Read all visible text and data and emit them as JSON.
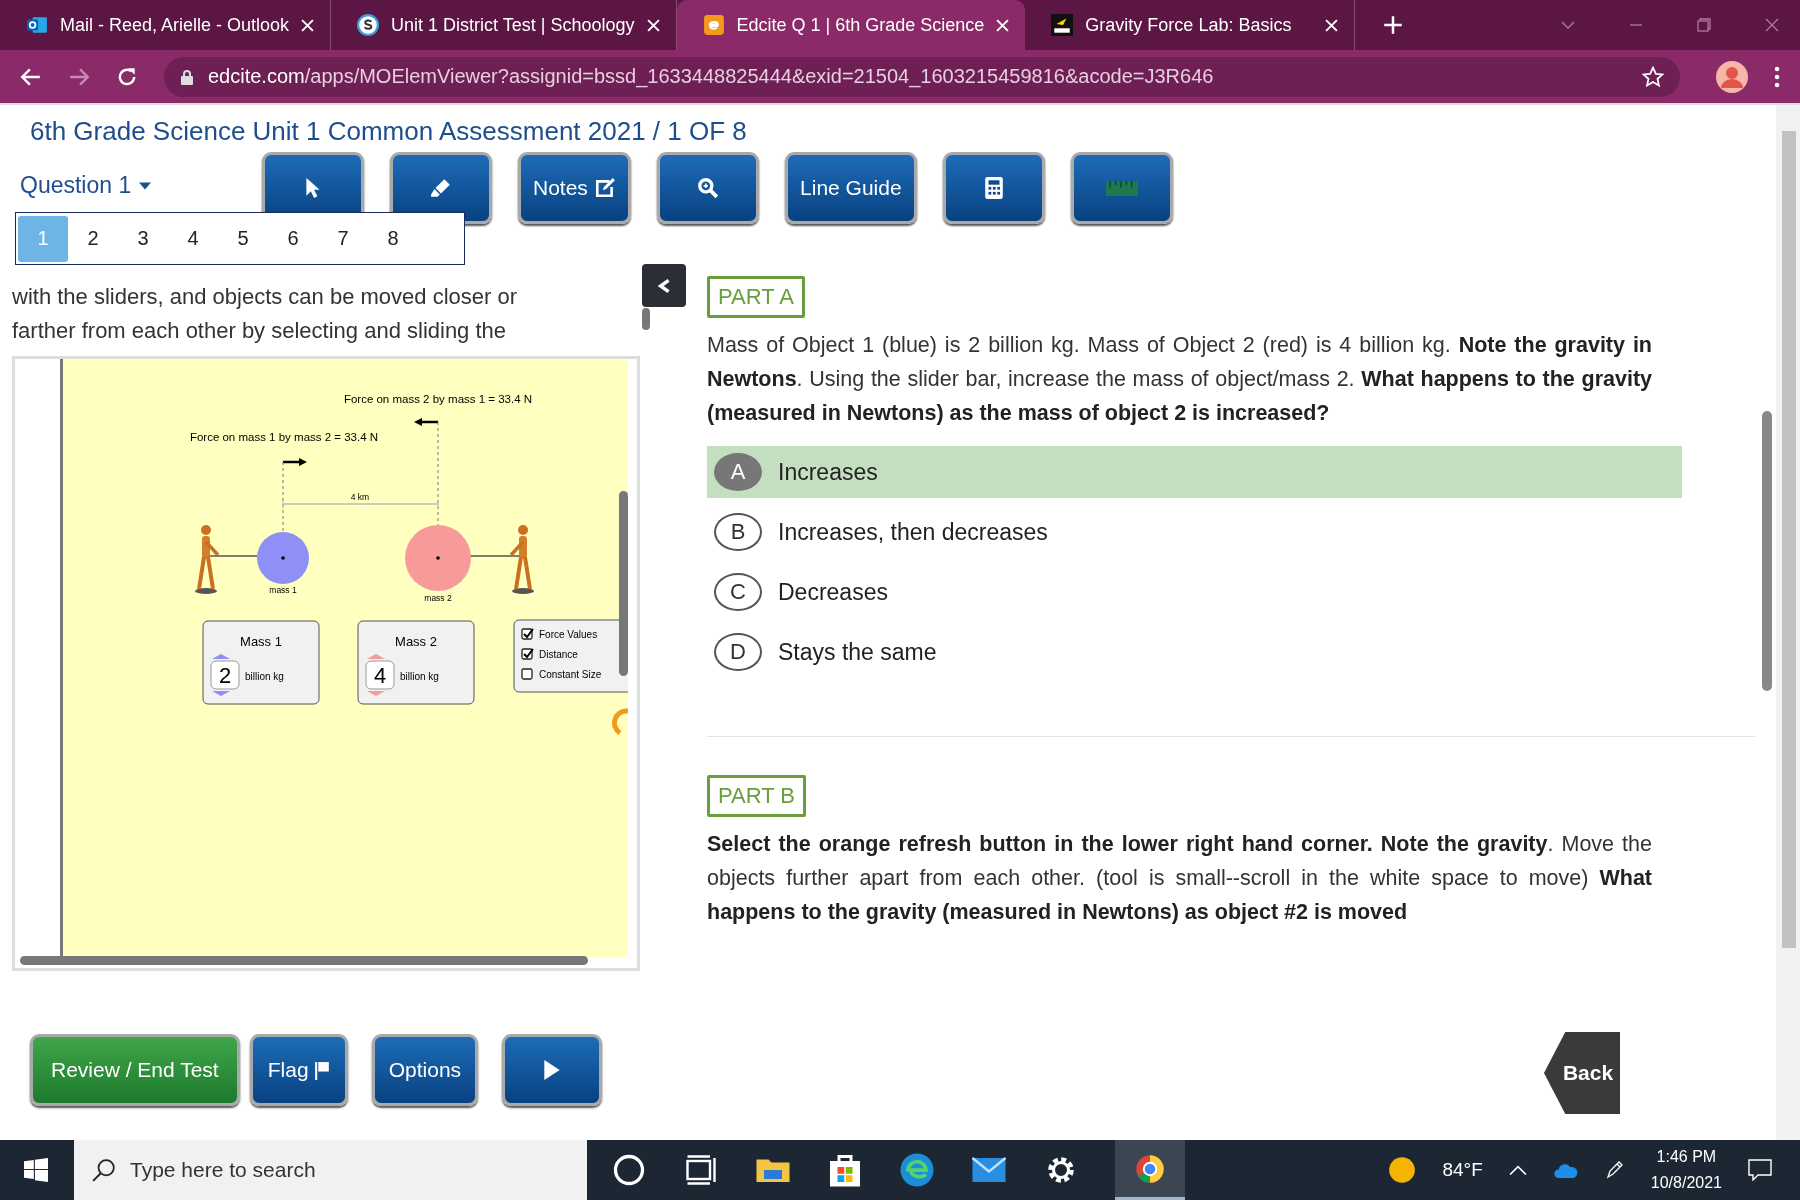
{
  "browser": {
    "tabs": [
      {
        "title": "Mail - Reed, Arielle - Outlook",
        "kind": "outlook",
        "selected": false
      },
      {
        "title": "Unit 1 District Test | Schoology",
        "kind": "schoology",
        "selected": false
      },
      {
        "title": "Edcite Q 1 | 6th Grade Science",
        "kind": "edcite",
        "selected": true
      },
      {
        "title": "Gravity Force Lab: Basics",
        "kind": "phet",
        "selected": false
      }
    ],
    "url_host": "edcite.com",
    "url_path": "/apps/MOElemViewer?assignid=bssd_1633448825444&exid=21504_1603215459816&acode=J3R646"
  },
  "assessment": {
    "title": "6th Grade Science Unit 1 Common Assessment 2021 / 1 OF 8",
    "question_menu": "Question 1",
    "questions": [
      {
        "label": "1",
        "selected": true
      },
      {
        "label": "2",
        "selected": false
      },
      {
        "label": "3",
        "selected": false
      },
      {
        "label": "4",
        "selected": false
      },
      {
        "label": "5",
        "selected": false
      },
      {
        "label": "6",
        "selected": false
      },
      {
        "label": "7",
        "selected": false
      },
      {
        "label": "8",
        "selected": false
      }
    ],
    "toolbar": [
      {
        "kind": "pointer"
      },
      {
        "kind": "highlighter"
      },
      {
        "kind": "notes",
        "label": "Notes"
      },
      {
        "kind": "zoom"
      },
      {
        "kind": "text",
        "label": "Line Guide"
      },
      {
        "kind": "calculator"
      },
      {
        "kind": "ruler"
      }
    ]
  },
  "passage": {
    "lines": [
      "with the sliders, and objects can be moved closer or",
      "farther from each other by selecting and sliding the"
    ]
  },
  "simulation": {
    "forces": [
      {
        "label": "Force on mass 1 by mass 2 = 33.4 N"
      },
      {
        "label": "Force on mass 2 by mass 1 = 33.4 N"
      }
    ],
    "distance": "4 km",
    "masses": [
      {
        "title": "Mass 1",
        "value": "2",
        "unit": "billion kg",
        "ball_label": "mass 1",
        "color": "#8f8ff8"
      },
      {
        "title": "Mass 2",
        "value": "4",
        "unit": "billion kg",
        "ball_label": "mass 2",
        "color": "#f79a9a"
      }
    ],
    "options": [
      {
        "label": "Force Values",
        "checked": true
      },
      {
        "label": "Distance",
        "checked": true
      },
      {
        "label": "Constant Size",
        "checked": false
      }
    ]
  },
  "part_a": {
    "heading": "PART A",
    "question": "Mass of Object 1 (blue) is 2 billion kg. Mass of Object 2 (red) is 4 billion kg. **Note the gravity in Newtons**. Using the slider bar, increase the mass of object/mass 2. **What happens to the gravity (measured in Newtons) as the mass of object 2 is increased?**",
    "choices": [
      {
        "letter": "A",
        "text": "Increases",
        "selected": true
      },
      {
        "letter": "B",
        "text": "Increases, then decreases",
        "selected": false
      },
      {
        "letter": "C",
        "text": "Decreases",
        "selected": false
      },
      {
        "letter": "D",
        "text": "Stays the same",
        "selected": false
      }
    ]
  },
  "part_b": {
    "heading": "PART B",
    "question": "**Select the orange refresh button in the lower right hand corner. Note the gravity**. Move the objects further apart from each other. (tool is small--scroll in the white space to move) **What happens to the gravity (measured in Newtons) as object #2 is moved**"
  },
  "footer": {
    "buttons": [
      {
        "kind": "review",
        "label": "Review / End Test"
      },
      {
        "kind": "flag",
        "label": "Flag"
      },
      {
        "kind": "text",
        "label": "Options"
      },
      {
        "kind": "next"
      }
    ],
    "back": "Back"
  },
  "taskbar": {
    "search_placeholder": "Type here to search",
    "weather": "84°F",
    "time": "1:46 PM",
    "date": "10/8/2021"
  }
}
